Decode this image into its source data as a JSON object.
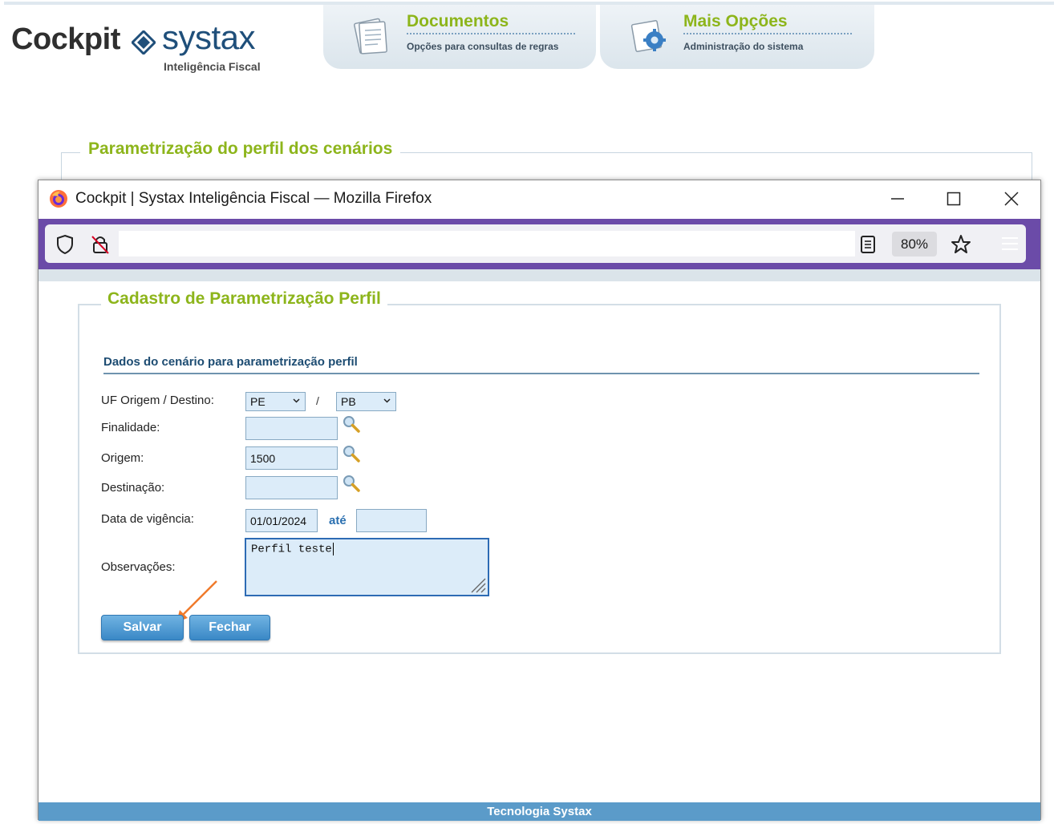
{
  "app": {
    "logo_left": "Cockpit",
    "logo_right": "systax",
    "logo_sub": "Inteligência Fiscal",
    "accent": "#8db51b",
    "brand": "#1f4f7a"
  },
  "menu": [
    {
      "title": "Documentos",
      "subtitle": "Opções para consultas de regras",
      "icon": "documents-icon"
    },
    {
      "title": "Mais Opções",
      "subtitle": "Administração do sistema",
      "icon": "settings-gear-icon"
    }
  ],
  "background_section": {
    "legend": "Parametrização do perfil dos cenários"
  },
  "browser": {
    "title": "Cockpit | Systax Inteligência Fiscal — Mozilla Firefox",
    "url": "",
    "zoom": "80%",
    "toolbar_color": "#6b4ba8"
  },
  "form": {
    "legend": "Cadastro de Parametrização Perfil",
    "section_title": "Dados do cenário para parametrização perfil",
    "labels": {
      "uf": "UF Origem / Destino:",
      "finalidade": "Finalidade:",
      "origem": "Origem:",
      "destinacao": "Destinação:",
      "vigencia": "Data de vigência:",
      "observacoes": "Observações:"
    },
    "uf_origem": "PE",
    "uf_separator": "/",
    "uf_destino": "PB",
    "finalidade": "",
    "origem": "1500",
    "destinacao": "",
    "vigencia_inicio": "01/01/2024",
    "vigencia_ate_label": "até",
    "vigencia_fim": "",
    "observacoes": "Perfil teste",
    "buttons": {
      "save": "Salvar",
      "close": "Fechar"
    }
  },
  "footer": {
    "text": "Tecnologia Systax"
  }
}
